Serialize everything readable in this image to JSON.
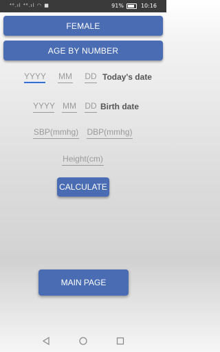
{
  "status_bar": {
    "signal_text": "⁴⁶.ıl ⁴⁶.ıl ◠ ■",
    "battery_percent": "91%",
    "time": "10:16"
  },
  "buttons": {
    "gender": "FEMALE",
    "age_mode": "AGE BY NUMBER",
    "calculate": "CALCULATE",
    "main_page": "MAIN PAGE"
  },
  "today": {
    "year_placeholder": "YYYY",
    "month_placeholder": "MM",
    "day_placeholder": "DD",
    "label": "Today's date"
  },
  "birth": {
    "year_placeholder": "YYYY",
    "month_placeholder": "MM",
    "day_placeholder": "DD",
    "label": "Birth date"
  },
  "bp": {
    "sbp_placeholder": "SBP(mmhg)",
    "dbp_placeholder": "DBP(mmhg)"
  },
  "height": {
    "placeholder": "Height(cm)"
  },
  "nav": {
    "back_icon": "back-triangle",
    "home_icon": "home-circle",
    "recents_icon": "recents-square"
  },
  "colors": {
    "button": "#4a6cb3",
    "focus": "#2f6fd6"
  }
}
